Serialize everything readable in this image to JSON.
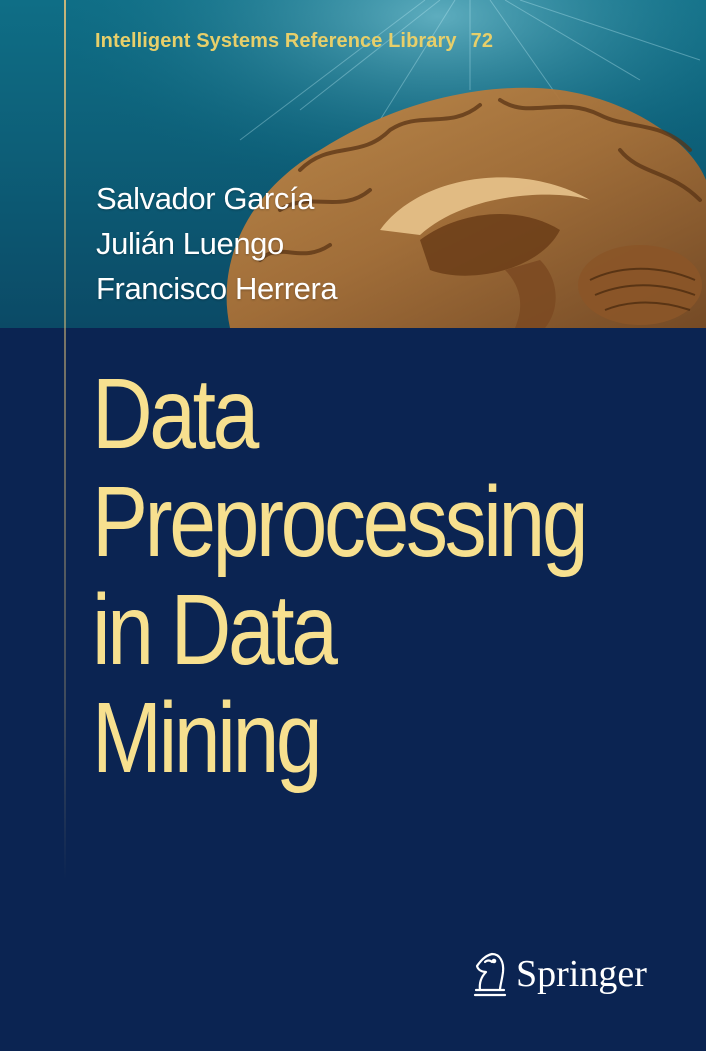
{
  "series": {
    "name": "Intelligent Systems Reference Library",
    "number": "72"
  },
  "authors": [
    "Salvador García",
    "Julián Luengo",
    "Francisco Herrera"
  ],
  "title": {
    "lines": [
      "Data",
      "Preprocessing",
      "in Data",
      "Mining"
    ]
  },
  "publisher": {
    "name": "Springer",
    "logo_icon": "springer-knight-icon"
  },
  "colors": {
    "background": "#0b2452",
    "band": "#0f6e86",
    "title": "#f7e08f",
    "series": "#e7cf6a",
    "authors": "#ffffff",
    "brain": "#b07a3e"
  }
}
